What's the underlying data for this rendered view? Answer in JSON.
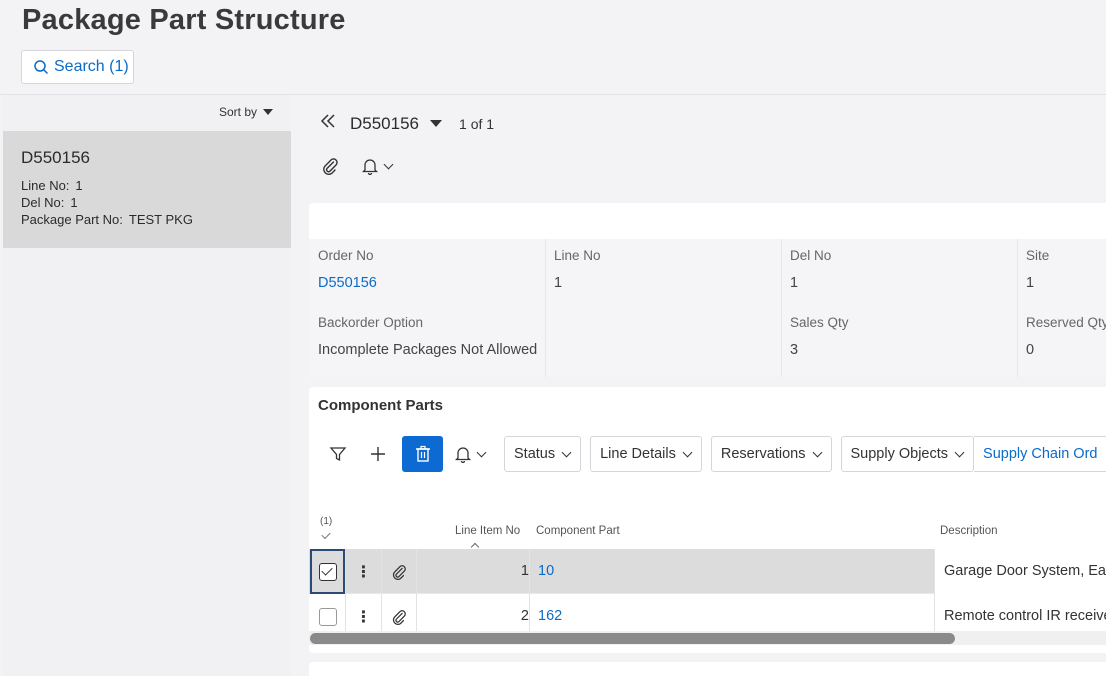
{
  "page": {
    "title": "Package Part Structure"
  },
  "search": {
    "label": "Search (1)"
  },
  "list": {
    "sort_label": "Sort by",
    "record": {
      "id": "D550156",
      "line_no_label": "Line No:",
      "line_no": "1",
      "del_no_label": "Del No:",
      "del_no": "1",
      "pkg_part_label": "Package Part No:",
      "pkg_part": "TEST PKG"
    }
  },
  "nav": {
    "record": "D550156",
    "count": "1 of 1"
  },
  "header": {
    "order_no_label": "Order No",
    "order_no": "D550156",
    "line_no_label": "Line No",
    "line_no": "1",
    "del_no_label": "Del No",
    "del_no": "1",
    "site_label": "Site",
    "site": "1",
    "backorder_label": "Backorder Option",
    "backorder": "Incomplete Packages Not Allowed",
    "sales_qty_label": "Sales Qty",
    "sales_qty": "3",
    "reserved_qty_label": "Reserved Qty",
    "reserved_qty": "0"
  },
  "components": {
    "title": "Component Parts",
    "toolbar": {
      "status": "Status",
      "line_details": "Line Details",
      "reservations": "Reservations",
      "supply_objects": "Supply Objects",
      "supply_chain": "Supply Chain Ord"
    },
    "columns": {
      "selected": "(1)",
      "line_item_no": "Line Item No",
      "component_part": "Component Part",
      "description": "Description"
    },
    "rows": [
      {
        "line_item_no": "1",
        "component_part": "10",
        "description": "Garage Door System, Easy",
        "selected": true
      },
      {
        "line_item_no": "2",
        "component_part": "162",
        "description": "Remote control IR receiver",
        "selected": false
      }
    ],
    "scroll_fraction": 0.81
  },
  "colors": {
    "accent": "#0a6bc9",
    "delete_button": "#0d6ad3",
    "selected_row": "#dcdcdc"
  },
  "icons": [
    "search-icon",
    "double-chevron-left-icon",
    "paperclip-icon",
    "bell-icon",
    "filter-icon",
    "plus-icon",
    "trash-icon",
    "kebab-icon"
  ]
}
